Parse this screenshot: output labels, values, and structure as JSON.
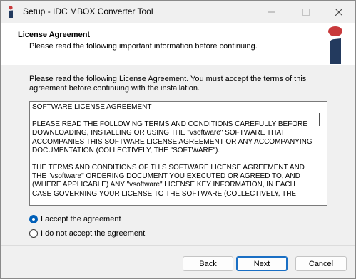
{
  "window": {
    "title": "Setup - IDC MBOX Converter Tool"
  },
  "header": {
    "title": "License Agreement",
    "subtitle": "Please read the following important information before continuing."
  },
  "intro_text": "Please read the following License Agreement. You must accept the terms of this agreement before continuing with the installation.",
  "license": {
    "heading": "SOFTWARE LICENSE AGREEMENT",
    "paragraph1": "PLEASE READ THE FOLLOWING TERMS AND CONDITIONS CAREFULLY BEFORE DOWNLOADING, INSTALLING OR USING THE \"vsoftware\" SOFTWARE THAT ACCOMPANIES THIS SOFTWARE LICENSE AGREEMENT OR ANY ACCOMPANYING DOCUMENTATION (COLLECTIVELY, THE \"SOFTWARE\").",
    "paragraph2": "THE TERMS AND CONDITIONS OF THIS SOFTWARE LICENSE AGREEMENT AND THE \"vsoftware\" ORDERING DOCUMENT YOU EXECUTED OR AGREED TO, AND (WHERE APPLICABLE) ANY \"vsoftware\" LICENSE KEY INFORMATION, IN EACH CASE GOVERNING YOUR LICENSE TO THE SOFTWARE (COLLECTIVELY, THE"
  },
  "options": {
    "accept_label": "I accept the agreement",
    "decline_label": "I do not accept the agreement",
    "selected": "accept"
  },
  "buttons": {
    "back": "Back",
    "next": "Next",
    "cancel": "Cancel"
  },
  "colors": {
    "accent": "#005fb8",
    "logo_red": "#c8393b",
    "logo_navy": "#233a5e"
  },
  "icons": {
    "app": "idc-logo-icon",
    "minimize": "minimize-icon",
    "maximize": "maximize-icon",
    "close": "close-icon"
  }
}
